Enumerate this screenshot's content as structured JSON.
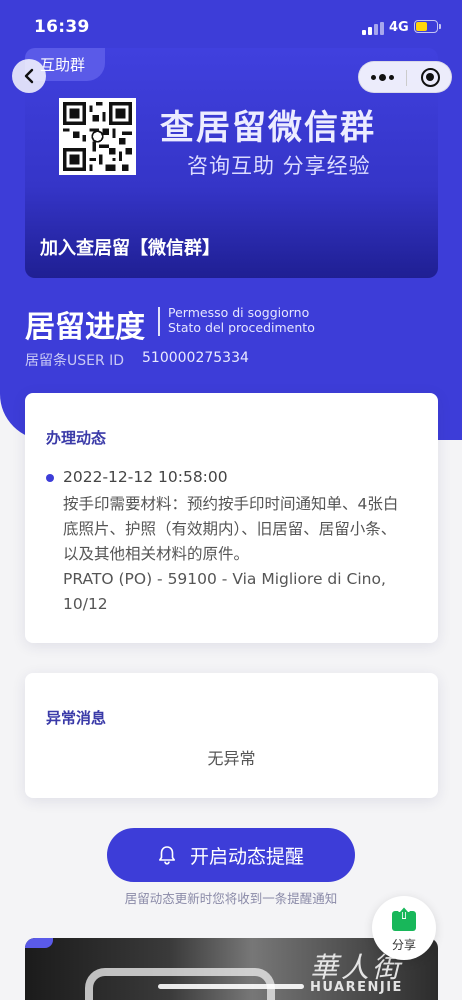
{
  "status_bar": {
    "time": "16:39",
    "network": "4G"
  },
  "banner": {
    "tag": "互助群",
    "title": "查居留微信群",
    "subtitle": "咨询互助 分享经验",
    "join_label": "加入查居留【微信群】"
  },
  "header": {
    "title": "居留进度",
    "subtitle_it_line1": "Permesso di soggiorno",
    "subtitle_it_line2": "Stato del procedimento",
    "user_id_label": "居留条USER ID",
    "user_id_value": "510000275334"
  },
  "progress_card": {
    "title": "办理动态",
    "events": [
      {
        "time": "2022-12-12 10:58:00",
        "lines": [
          "按手印需要材料：预约按手印时间通知单、4张白",
          "底照片、护照（有效期内）、旧居留、居留小条、",
          "以及其他相关材料的原件。",
          "PRATO (PO) - 59100 - Via Migliore di Cino,",
          "10/12"
        ]
      }
    ]
  },
  "anomaly_card": {
    "title": "异常消息",
    "message": "无异常"
  },
  "reminder": {
    "button_label": "开启动态提醒",
    "note": "居留动态更新时您将收到一条提醒通知"
  },
  "share": {
    "label": "分享"
  },
  "watermark": {
    "mark": "華人街",
    "text": "HUARENJIE"
  },
  "colors": {
    "primary": "#3d3dd8",
    "card_title": "#3a3aa8",
    "background": "#f4f4f6"
  }
}
